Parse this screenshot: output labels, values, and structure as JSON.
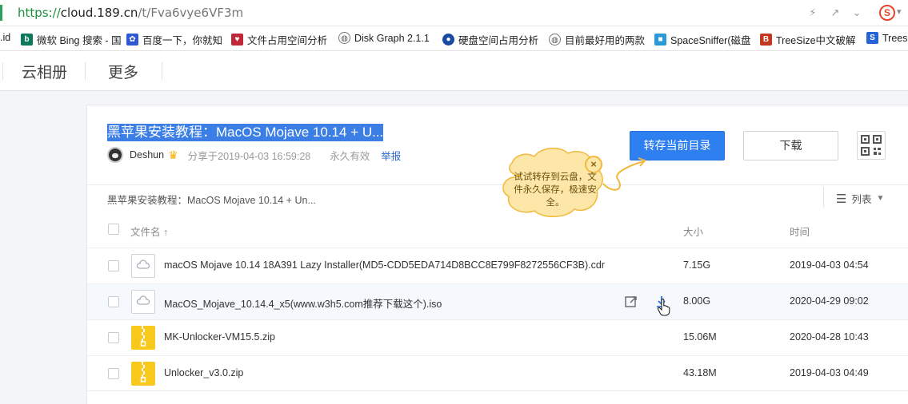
{
  "browser": {
    "url_scheme": "https://",
    "url_rest_host": "cloud.189.cn",
    "url_path": "/t/Fva6vye6VF3m",
    "search_engine_letter": "S"
  },
  "bookmarks": [
    {
      "label": ".id",
      "icon": "none"
    },
    {
      "label": "微软 Bing 搜索 - 国",
      "icon": "bing-icon",
      "color": "#0b7a5b"
    },
    {
      "label": "百度一下，你就知",
      "icon": "baidu-icon",
      "color": "#2f59d4"
    },
    {
      "label": "文件占用空间分析",
      "icon": "heart-icon",
      "color": "#c0283a"
    },
    {
      "label": "Disk Graph 2.1.1",
      "icon": "globe-icon",
      "color": "#555"
    },
    {
      "label": "硬盘空间占用分析",
      "icon": "disk-icon",
      "color": "#1a4aa3"
    },
    {
      "label": "目前最好用的两款",
      "icon": "globe-icon",
      "color": "#555"
    },
    {
      "label": "SpaceSniffer(磁盘",
      "icon": "spacesniffer-icon",
      "color": "#2a9ad6"
    },
    {
      "label": "TreeSize中文破解",
      "icon": "treesize-icon",
      "color": "#c43620"
    },
    {
      "label": "Trees",
      "icon": "treesize-icon",
      "color": "#2563d6"
    }
  ],
  "nav": {
    "album": "云相册",
    "more": "更多"
  },
  "share": {
    "title": "黑苹果安装教程：MacOS Mojave 10.14 + U...",
    "owner": "Deshun",
    "shared_at": "分享于2019-04-03 16:59:28",
    "validity": "永久有效",
    "report": "举报",
    "save_button": "转存当前目录",
    "download_button": "下载",
    "breadcrumb": "黑苹果安装教程：MacOS Mojave 10.14 + Un...",
    "view_mode": "列表"
  },
  "tooltip": {
    "text": "试试转存到云盘，文件永久保存，极速安全。",
    "close": "×"
  },
  "table": {
    "col_name": "文件名 ↑",
    "col_size": "大小",
    "col_time": "时间",
    "rows": [
      {
        "name": "macOS Mojave 10.14 18A391 Lazy Installer(MD5-CDD5EDA714D8BCC8E799F8272556CF3B).cdr",
        "size": "7.15G",
        "time": "2019-04-03 04:54",
        "type": "unknown"
      },
      {
        "name": "MacOS_Mojave_10.14.4_x5(www.w3h5.com推荐下载这个).iso",
        "size": "8.00G",
        "time": "2020-04-29 09:02",
        "type": "unknown"
      },
      {
        "name": "MK-Unlocker-VM15.5.zip",
        "size": "15.06M",
        "time": "2020-04-28 10:43",
        "type": "zip"
      },
      {
        "name": "Unlocker_v3.0.zip",
        "size": "43.18M",
        "time": "2019-04-03 04:49",
        "type": "zip"
      }
    ]
  },
  "colors": {
    "primary": "#2e7ff0",
    "title_highlight": "#3a7ee6",
    "zip": "#f8c81c",
    "tooltip_bg": "#fde7a8"
  }
}
